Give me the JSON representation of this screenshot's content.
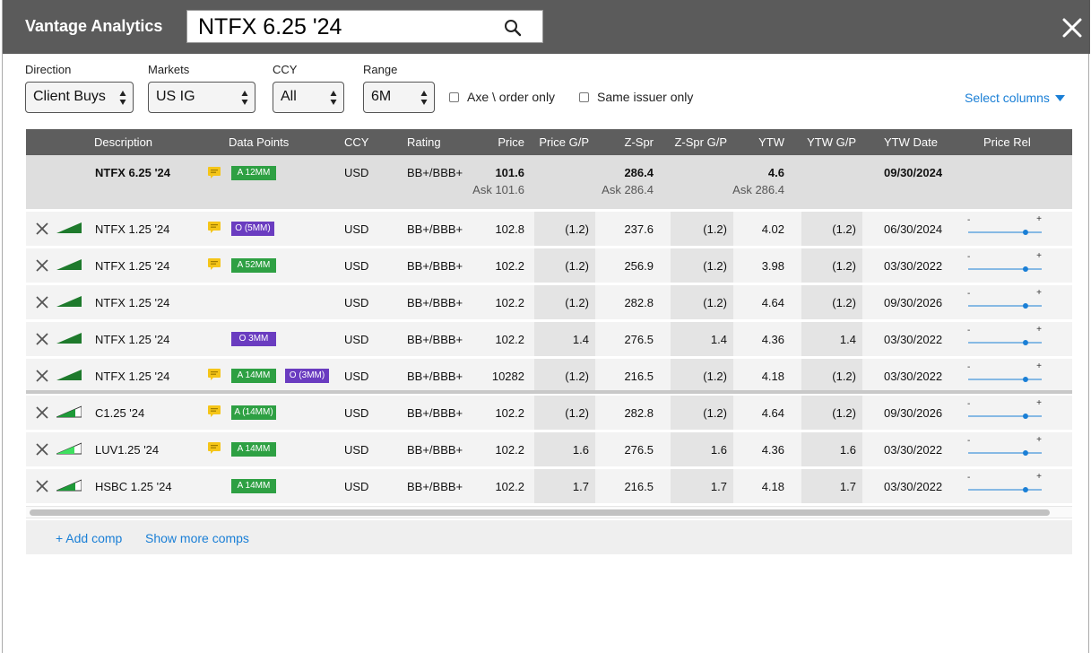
{
  "app": {
    "title": "Vantage Analytics"
  },
  "search": {
    "value": "NTFX 6.25 '24",
    "icon": "search-icon"
  },
  "filters": {
    "direction": {
      "label": "Direction",
      "value": "Client Buys"
    },
    "markets": {
      "label": "Markets",
      "value": "US IG"
    },
    "ccy": {
      "label": "CCY",
      "value": "All"
    },
    "range": {
      "label": "Range",
      "value": "6M"
    },
    "axe_only": {
      "label": "Axe \\ order only",
      "checked": false
    },
    "same_issuer": {
      "label": "Same issuer only",
      "checked": false
    },
    "select_columns": "Select columns"
  },
  "columns": [
    "Description",
    "Data Points",
    "CCY",
    "Rating",
    "Price",
    "Price G/P",
    "Z-Spr",
    "Z-Spr G/P",
    "YTW",
    "YTW G/P",
    "YTW Date",
    "Price Rel"
  ],
  "primary": {
    "description": "NTFX 6.25 '24",
    "tag": "A 12MM",
    "ccy": "USD",
    "rating": "BB+/BBB+",
    "price": "101.6",
    "price_ask": "Ask 101.6",
    "zspr": "286.4",
    "zspr_ask": "Ask 286.4",
    "ytw": "4.6",
    "ytw_ask": "Ask 286.4",
    "ytw_date": "09/30/2024"
  },
  "rows": [
    {
      "description": "NTFX 1.25 '24",
      "chat": true,
      "tags": [
        {
          "label": "O (5MM)",
          "color": "purple"
        }
      ],
      "ccy": "USD",
      "rating": "BB+/BBB+",
      "price": "102.8",
      "price_gp": "(1.2)",
      "zspr": "237.6",
      "zspr_gp": "(1.2)",
      "ytw": "4.02",
      "ytw_gp": "(1.2)",
      "ytw_date": "06/30/2024",
      "signal": "full"
    },
    {
      "description": "NTFX 1.25 '24",
      "chat": true,
      "tags": [
        {
          "label": "A 52MM",
          "color": "green"
        }
      ],
      "ccy": "USD",
      "rating": "BB+/BBB+",
      "price": "102.2",
      "price_gp": "(1.2)",
      "zspr": "256.9",
      "zspr_gp": "(1.2)",
      "ytw": "3.98",
      "ytw_gp": "(1.2)",
      "ytw_date": "03/30/2022",
      "signal": "full"
    },
    {
      "description": "NTFX 1.25 '24",
      "chat": false,
      "tags": [],
      "ccy": "USD",
      "rating": "BB+/BBB+",
      "price": "102.2",
      "price_gp": "(1.2)",
      "zspr": "282.8",
      "zspr_gp": "(1.2)",
      "ytw": "4.64",
      "ytw_gp": "(1.2)",
      "ytw_date": "09/30/2026",
      "signal": "full"
    },
    {
      "description": "NTFX 1.25 '24",
      "chat": false,
      "tags": [
        {
          "label": "O 3MM",
          "color": "purple"
        }
      ],
      "ccy": "USD",
      "rating": "BB+/BBB+",
      "price": "102.2",
      "price_gp": "1.4",
      "zspr": "276.5",
      "zspr_gp": "1.4",
      "ytw": "4.36",
      "ytw_gp": "1.4",
      "ytw_date": "03/30/2022",
      "signal": "full"
    },
    {
      "description": "NTFX 1.25 '24",
      "chat": true,
      "tags": [
        {
          "label": "A 14MM",
          "color": "green"
        },
        {
          "label": "O (3MM)",
          "color": "purple"
        }
      ],
      "ccy": "USD",
      "rating": "BB+/BBB+",
      "price": "10282",
      "price_gp": "(1.2)",
      "zspr": "216.5",
      "zspr_gp": "(1.2)",
      "ytw": "4.18",
      "ytw_gp": "(1.2)",
      "ytw_date": "03/30/2022",
      "signal": "full"
    },
    {
      "description": "C1.25 '24",
      "chat": true,
      "tags": [
        {
          "label": "A (14MM)",
          "color": "green"
        }
      ],
      "ccy": "USD",
      "rating": "BB+/BBB+",
      "price": "102.2",
      "price_gp": "(1.2)",
      "zspr": "282.8",
      "zspr_gp": "(1.2)",
      "ytw": "4.64",
      "ytw_gp": "(1.2)",
      "ytw_date": "09/30/2026",
      "signal": "partial"
    },
    {
      "description": "LUV1.25 '24",
      "chat": true,
      "tags": [
        {
          "label": "A 14MM",
          "color": "green"
        }
      ],
      "ccy": "USD",
      "rating": "BB+/BBB+",
      "price": "102.2",
      "price_gp": "1.6",
      "zspr": "276.5",
      "zspr_gp": "1.6",
      "ytw": "4.36",
      "ytw_gp": "1.6",
      "ytw_date": "03/30/2022",
      "signal": "light"
    },
    {
      "description": "HSBC 1.25 '24",
      "chat": false,
      "tags": [
        {
          "label": "A 14MM",
          "color": "green"
        }
      ],
      "ccy": "USD",
      "rating": "BB+/BBB+",
      "price": "102.2",
      "price_gp": "1.7",
      "zspr": "216.5",
      "zspr_gp": "1.7",
      "ytw": "4.18",
      "ytw_gp": "1.7",
      "ytw_date": "03/30/2022",
      "signal": "partial"
    }
  ],
  "price_rel": {
    "min_label": "-",
    "max_label": "+",
    "position": 0.78
  },
  "footer": {
    "add_comp": "+ Add comp",
    "show_more": "Show more comps"
  },
  "colors": {
    "titlebar": "#5b5b5b",
    "header": "#5e5e5e",
    "accent": "#1a7fd6",
    "green": "#2ea043",
    "purple": "#6a3cc0",
    "chat": "#f5c518"
  }
}
